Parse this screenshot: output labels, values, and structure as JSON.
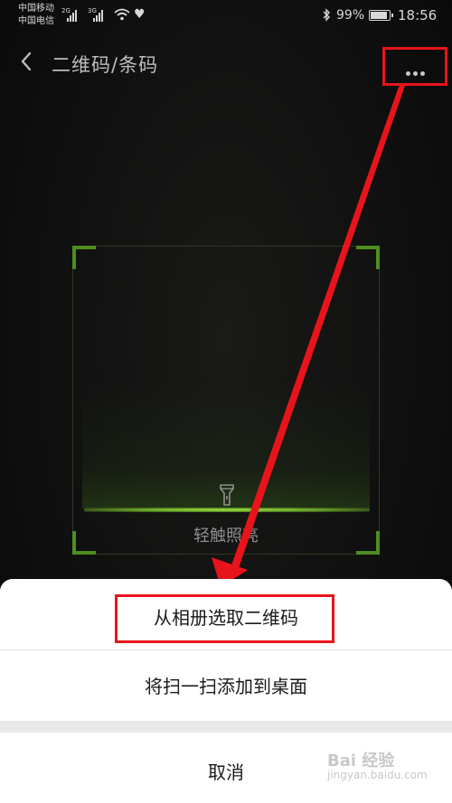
{
  "status_bar": {
    "carrier_1": "中国移动",
    "carrier_2": "中国电信",
    "network_1": "2G",
    "network_2": "3G",
    "battery_percent": "99%",
    "battery_level": 0.99,
    "time": "18:56",
    "icons": [
      "signal-icon",
      "wifi-icon",
      "heart-rate-icon",
      "bluetooth-icon",
      "battery-icon"
    ]
  },
  "titlebar": {
    "back_icon": "chevron-left-icon",
    "title": "二维码/条码",
    "more_icon": "more-dots-icon"
  },
  "scanner": {
    "torch_icon": "flashlight-icon",
    "torch_label": "轻触照亮",
    "accent_color": "#4e8e1f"
  },
  "annotation": {
    "highlight_color": "#e8141c"
  },
  "action_sheet": {
    "option_album": "从相册选取二维码",
    "option_add_desktop": "将扫一扫添加到桌面",
    "cancel": "取消"
  },
  "watermark": {
    "text": "Bai 经验",
    "sub": "jingyan.baidu.com"
  }
}
